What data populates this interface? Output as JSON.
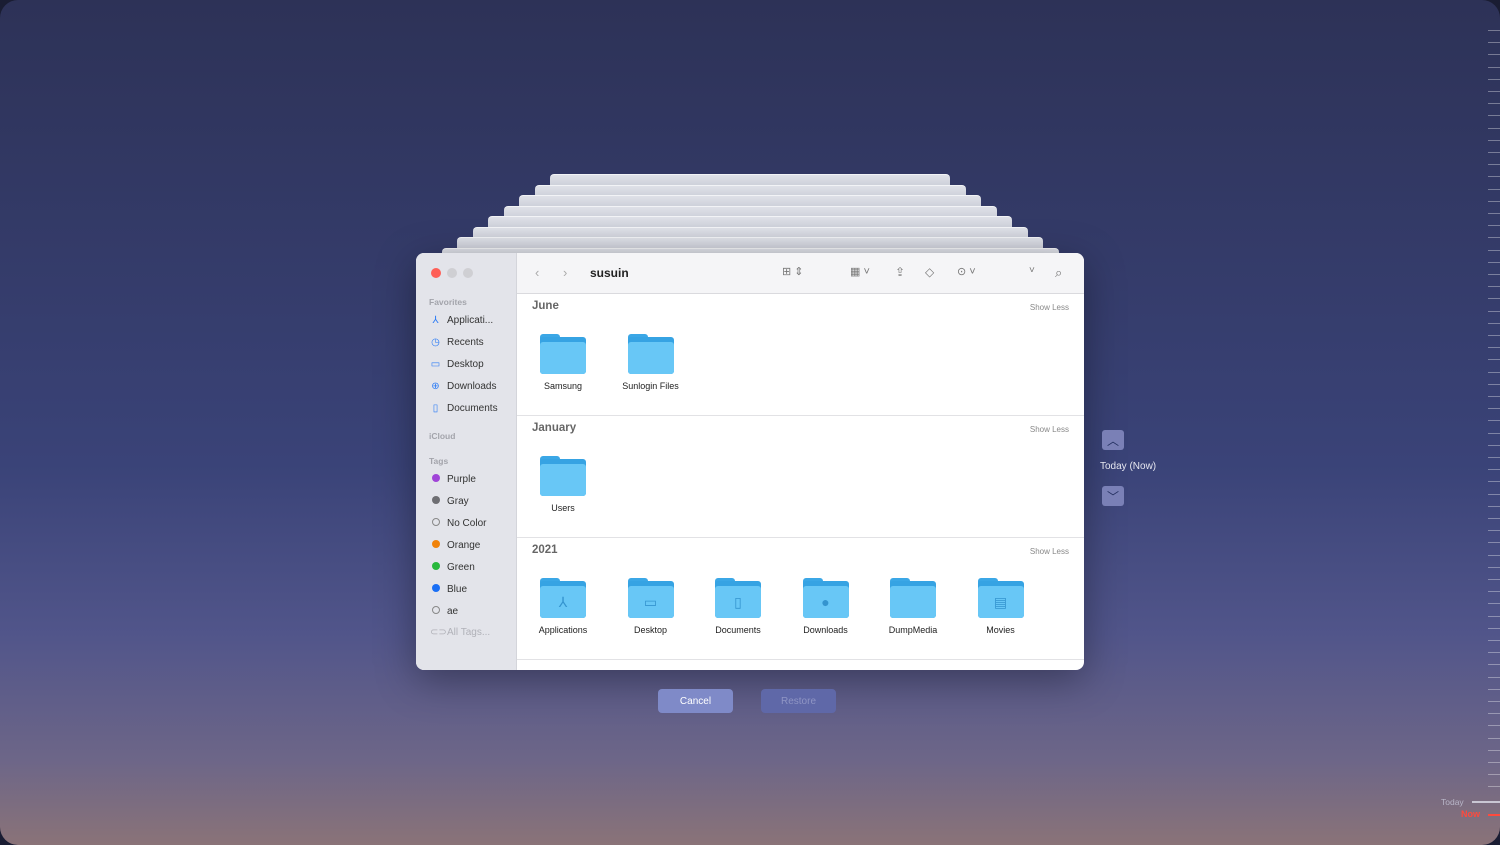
{
  "window": {
    "title": "susuin"
  },
  "sidebar": {
    "favorites_header": "Favorites",
    "favorites": [
      {
        "label": "Applicati...",
        "icon": "applications-icon"
      },
      {
        "label": "Recents",
        "icon": "clock-icon"
      },
      {
        "label": "Desktop",
        "icon": "desktop-icon"
      },
      {
        "label": "Downloads",
        "icon": "download-icon"
      },
      {
        "label": "Documents",
        "icon": "document-icon"
      }
    ],
    "icloud_header": "iCloud",
    "tags_header": "Tags",
    "tags": [
      {
        "label": "Purple",
        "color": "#a044d8"
      },
      {
        "label": "Gray",
        "color": "#6e6e73"
      },
      {
        "label": "No Color",
        "color": ""
      },
      {
        "label": "Orange",
        "color": "#f0820a"
      },
      {
        "label": "Green",
        "color": "#28b83c"
      },
      {
        "label": "Blue",
        "color": "#1a6ff5"
      },
      {
        "label": "ae",
        "color": ""
      }
    ],
    "all_tags": "All Tags..."
  },
  "sections": [
    {
      "title": "June",
      "action": "Show Less",
      "items": [
        {
          "label": "Samsung",
          "icon": "folder-icon"
        },
        {
          "label": "Sunlogin Files",
          "icon": "folder-icon"
        }
      ]
    },
    {
      "title": "January",
      "action": "Show Less",
      "items": [
        {
          "label": "Users",
          "icon": "folder-icon"
        }
      ]
    },
    {
      "title": "2021",
      "action": "Show Less",
      "items": [
        {
          "label": "Applications",
          "icon": "applications-folder-icon"
        },
        {
          "label": "Desktop",
          "icon": "desktop-folder-icon"
        },
        {
          "label": "Documents",
          "icon": "documents-folder-icon"
        },
        {
          "label": "Downloads",
          "icon": "downloads-folder-icon"
        },
        {
          "label": "DumpMedia",
          "icon": "folder-icon"
        },
        {
          "label": "Movies",
          "icon": "movies-folder-icon"
        }
      ]
    }
  ],
  "buttons": {
    "cancel": "Cancel",
    "restore": "Restore"
  },
  "navigator": {
    "current": "Today (Now)"
  },
  "timeline": {
    "today": "Today",
    "now": "Now"
  },
  "colors": {
    "now": "#ff4a3d",
    "accent": "#7a80b6"
  }
}
